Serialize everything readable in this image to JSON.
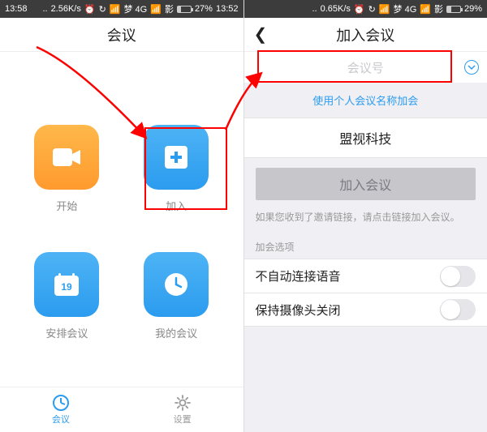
{
  "left": {
    "statusbar": {
      "time": "13:58",
      "speed": "2.56K/s",
      "network": "梦 4G",
      "battery": "27%",
      "time_right": "13:52"
    },
    "title": "会议",
    "tiles": {
      "start": {
        "label": "开始"
      },
      "join": {
        "label": "加入"
      },
      "schedule": {
        "label": "安排会议",
        "date": "19"
      },
      "mine": {
        "label": "我的会议"
      }
    },
    "tabs": {
      "meeting": "会议",
      "settings": "设置"
    }
  },
  "right": {
    "statusbar": {
      "speed": "0.65K/s",
      "network": "梦 4G",
      "battery": "29%"
    },
    "title": "加入会议",
    "id_placeholder": "会议号",
    "use_personal": "使用个人会议名称加会",
    "org": "盟视科技",
    "join_btn": "加入会议",
    "hint": "如果您收到了邀请链接，请点击链接加入会议。",
    "section": "加会选项",
    "opt_audio": "不自动连接语音",
    "opt_camera": "保持摄像头关闭"
  }
}
